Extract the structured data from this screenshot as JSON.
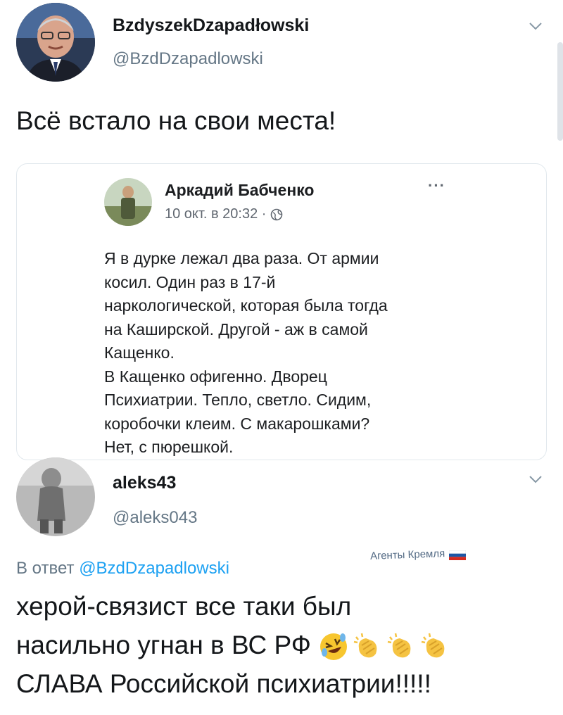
{
  "tweet": {
    "display_name": "BzdyszekDzapadłowski",
    "handle": "@BzdDzapadlowski",
    "text": "Всё встало на свои места!"
  },
  "quoted_post": {
    "author": "Аркадий Бабченко",
    "date": "10 окт. в 20:32 ·",
    "more_label": "···",
    "lines": [
      "Я в дурке лежал два раза. От армии",
      "косил. Один раз в 17-й",
      "наркологической, которая была тогда",
      "на Каширской. Другой - аж в самой",
      "Кащенко.",
      "В Кащенко офигенно. Дворец",
      "Психиатрии. Тепло, светло. Сидим,",
      "коробочки клеим. С макарошками?",
      "Нет, с пюрешкой."
    ]
  },
  "reply": {
    "display_name": "aleks43",
    "handle": "@aleks043",
    "reply_prefix": "В ответ",
    "reply_handle": "@BzdDzapadlowski",
    "line1": "херой-связист все таки был",
    "line2": "насильно угнан в ВС РФ",
    "line3": "СЛАВА Российской психиатрии!!!!!",
    "emojis": [
      "rolling-laughing-emoji",
      "clapping-emoji",
      "clapping-emoji",
      "clapping-emoji"
    ]
  },
  "watermark": "Агенты Кремля",
  "colors": {
    "link": "#1da1f2",
    "muted": "#657786",
    "border": "#e1e8ed"
  }
}
